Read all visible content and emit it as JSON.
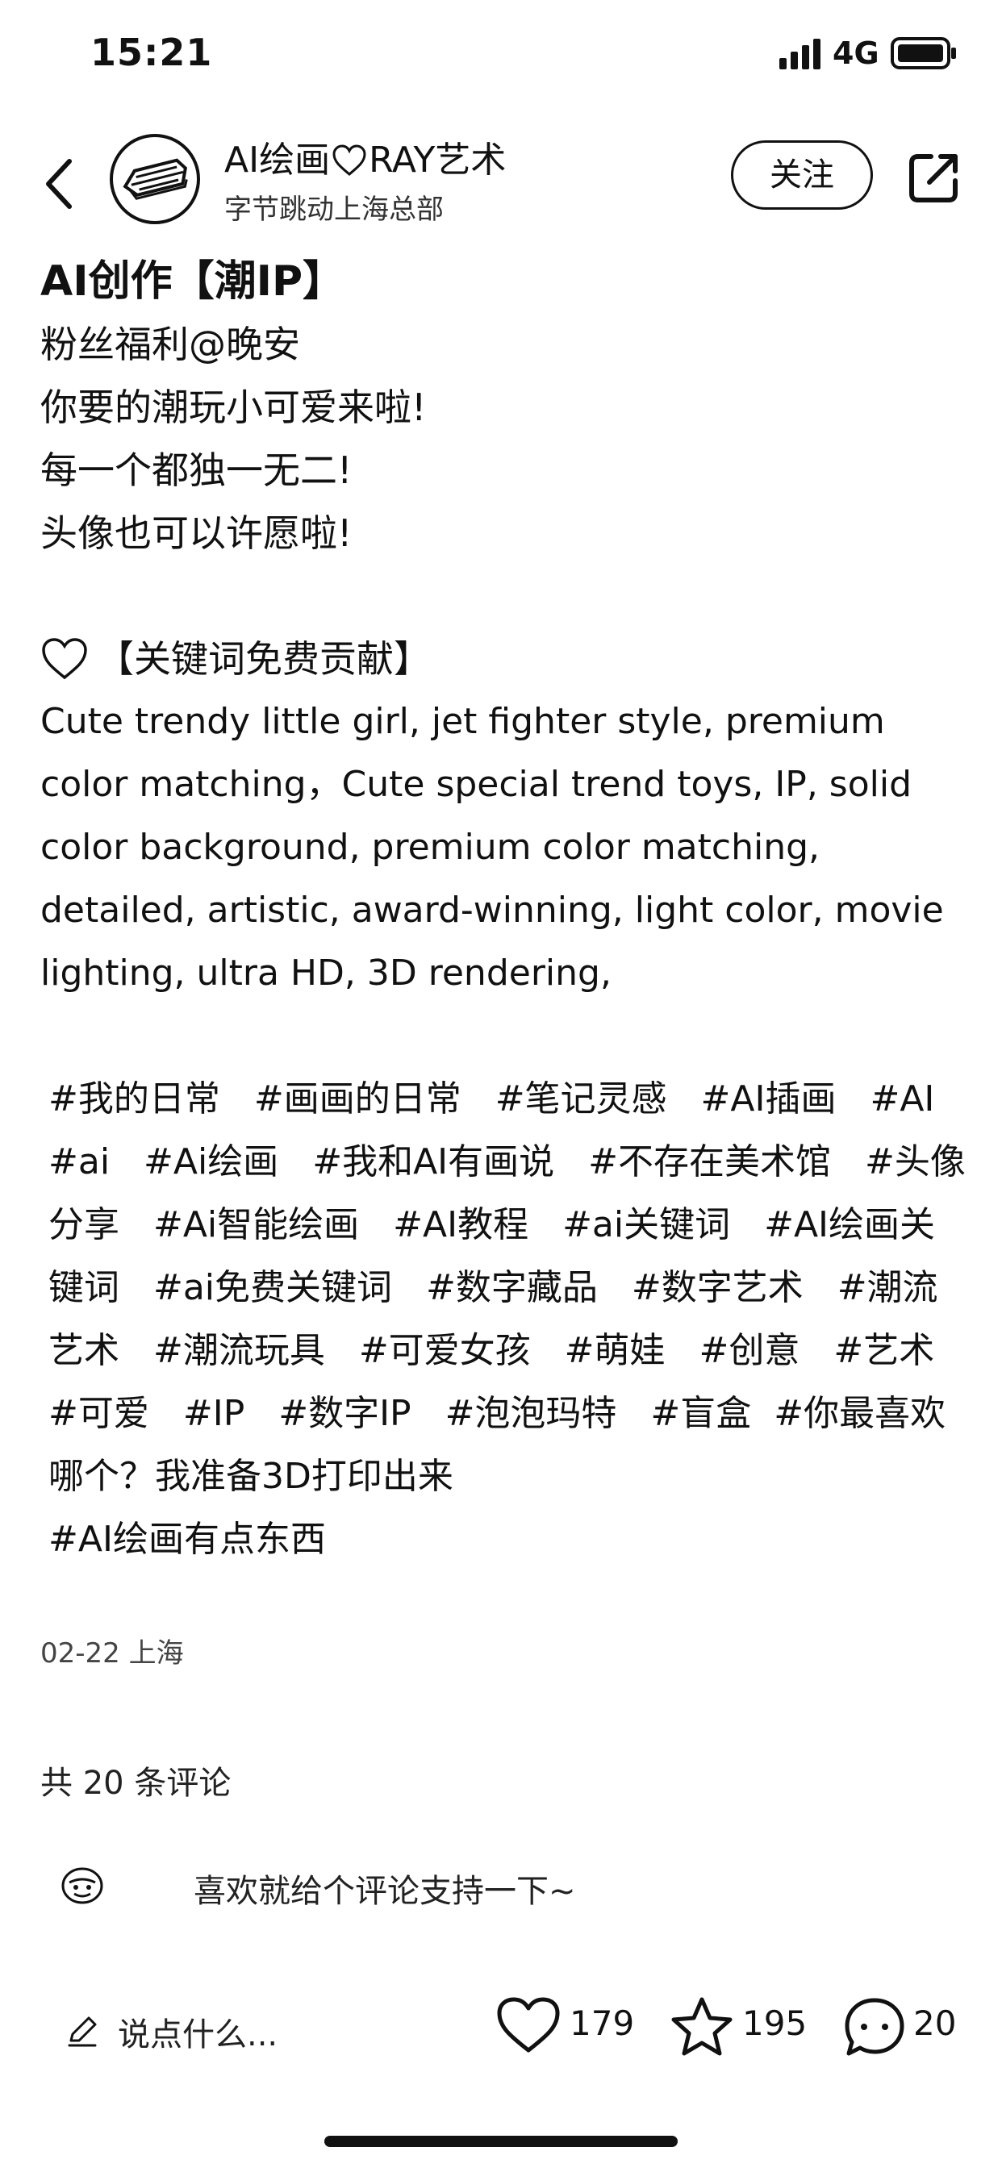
{
  "status_bar": {
    "time": "15:21",
    "network": "4G"
  },
  "header": {
    "author_name_part1": "AI绘画",
    "author_name_part2": "RAY艺术",
    "author_sub": "字节跳动上海总部",
    "follow_label": "关注"
  },
  "post": {
    "title": "AI创作【潮IP】",
    "lines": [
      "粉丝福利@晚安",
      "你要的潮玩小可爱来啦!",
      "每一个都独一无二!",
      "头像也可以许愿啦!"
    ],
    "keywords_heading": "【关键词免费贡献】",
    "keywords_text": "Cute trendy little girl, jet fighter style, premium color matching，Cute special trend toys, IP, solid color background, premium color matching, detailed, artistic, award-winning, light color, movie lighting, ultra HD, 3D rendering,",
    "tags": [
      "#我的日常",
      "#画画的日常",
      "#笔记灵感",
      "#AI插画",
      "#AI",
      "#ai",
      "#Ai绘画",
      "#我和AI有画说",
      "#不存在美术馆",
      "#头像分享",
      "#Ai智能绘画",
      "#AI教程",
      "#ai关键词",
      "#AI绘画关键词",
      "#ai免费关键词",
      "#数字藏品",
      "#数字艺术",
      "#潮流艺术",
      "#潮流玩具",
      "#可爱女孩",
      "#萌娃",
      "#创意",
      "#艺术",
      "#可爱",
      "#IP",
      "#数字IP",
      "#泡泡玛特",
      "#盲盒",
      "#你最喜欢哪个？我准备3D打印出来"
    ],
    "last_tag": "#AI绘画有点东西",
    "meta": "02-22 上海"
  },
  "comments": {
    "count_label": "共 20 条评论",
    "prompt": "喜欢就给个评论支持一下~"
  },
  "bottom_bar": {
    "input_placeholder": "说点什么...",
    "likes": "179",
    "favorites": "195",
    "comments": "20"
  },
  "icons": {
    "back": "chevron-left-icon",
    "share": "share-icon",
    "heart": "heart-icon",
    "star": "star-icon",
    "comment": "comment-bubble-icon",
    "pencil": "pencil-icon",
    "emoji": "emoji-icon"
  }
}
